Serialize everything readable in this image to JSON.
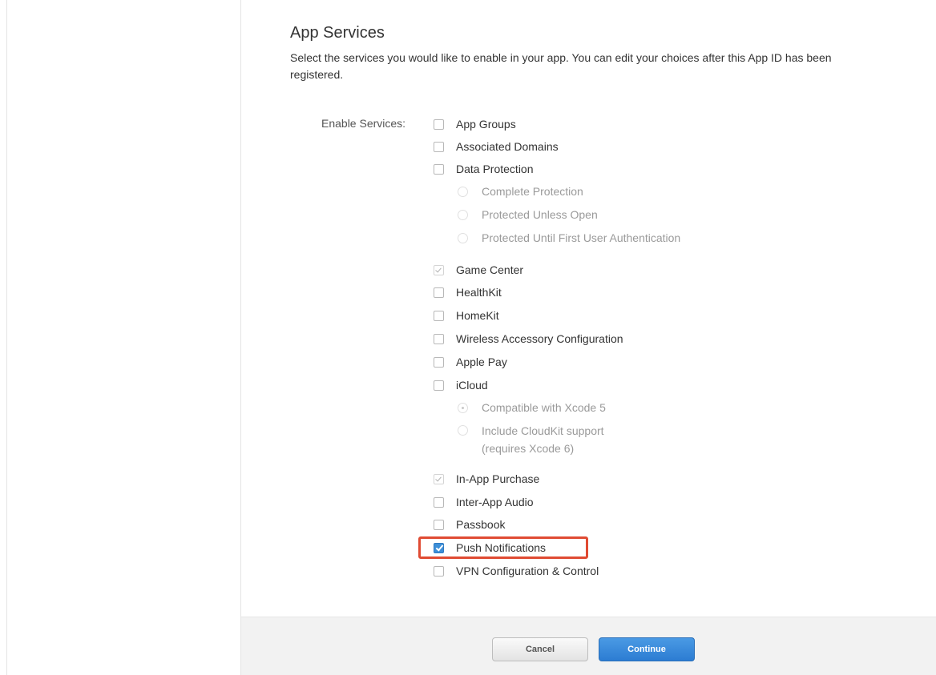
{
  "section": {
    "title": "App Services",
    "description": "Select the services you would like to enable in your app. You can edit your choices after this App ID has been registered."
  },
  "enable_label": "Enable Services:",
  "services": {
    "app_groups": "App Groups",
    "associated_domains": "Associated Domains",
    "data_protection": "Data Protection",
    "dp_complete": "Complete Protection",
    "dp_unless_open": "Protected Unless Open",
    "dp_until_auth": "Protected Until First User Authentication",
    "game_center": "Game Center",
    "healthkit": "HealthKit",
    "homekit": "HomeKit",
    "wireless_accessory": "Wireless Accessory Configuration",
    "apple_pay": "Apple Pay",
    "icloud": "iCloud",
    "icloud_xcode5": "Compatible with Xcode 5",
    "icloud_cloudkit_line1": "Include CloudKit support",
    "icloud_cloudkit_line2": "(requires Xcode 6)",
    "in_app_purchase": "In-App Purchase",
    "inter_app_audio": "Inter-App Audio",
    "passbook": "Passbook",
    "push_notifications": "Push Notifications",
    "vpn": "VPN Configuration & Control"
  },
  "buttons": {
    "cancel": "Cancel",
    "continue": "Continue"
  },
  "colors": {
    "accent": "#3d8fd8",
    "highlight": "#e04b33"
  }
}
